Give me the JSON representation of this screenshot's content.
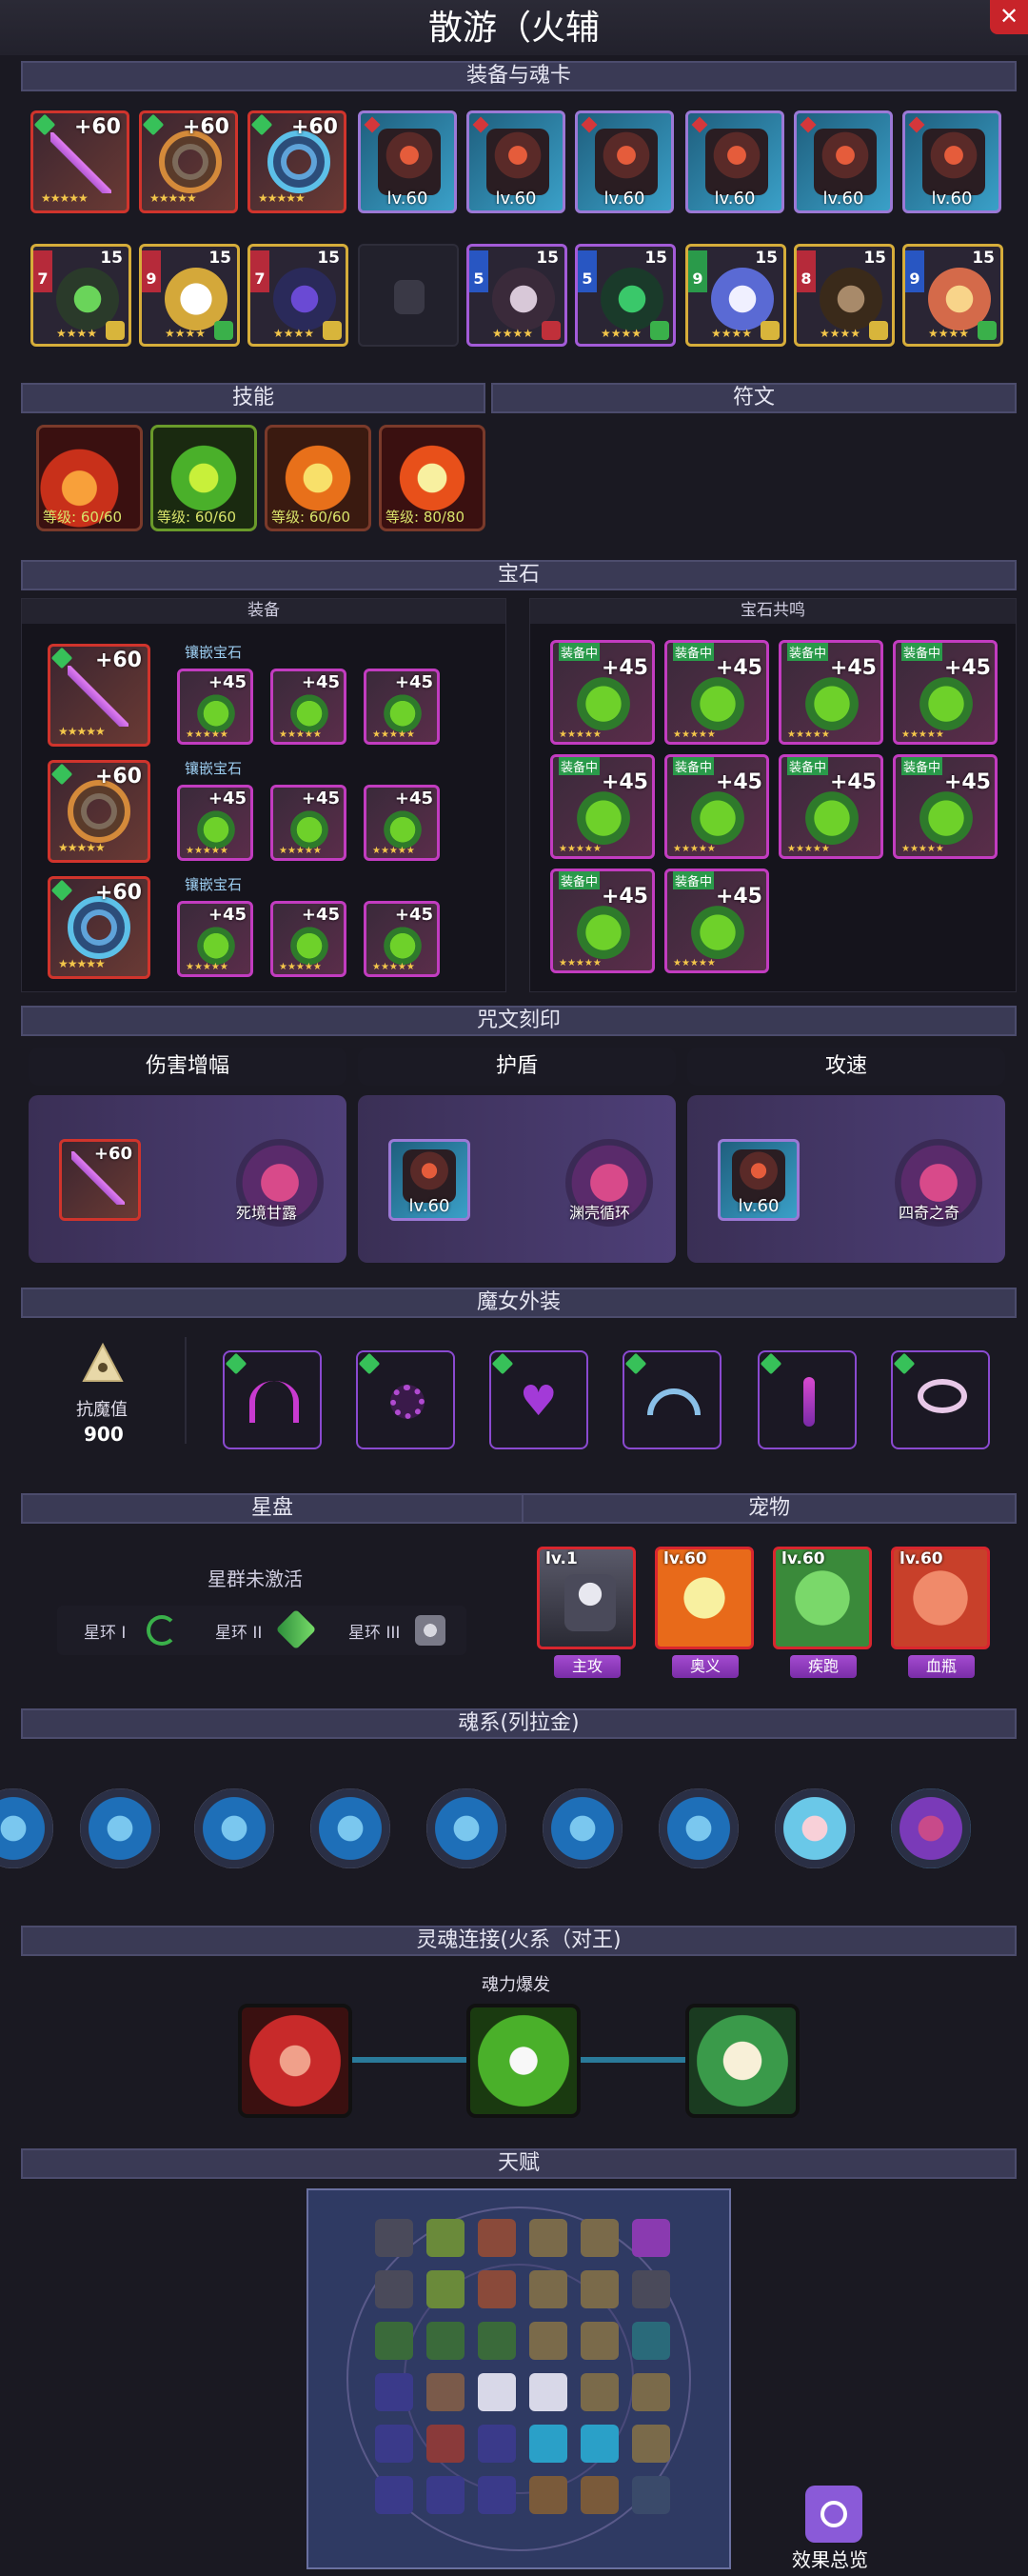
{
  "window": {
    "title": "散游（火辅"
  },
  "sections": {
    "equip_cards": "装备与魂卡",
    "skills": "技能",
    "runes": "符文",
    "gems": "宝石",
    "gems_equip": "装备",
    "gems_resonance": "宝石共鸣",
    "curse": "咒文刻印",
    "witch": "魔女外装",
    "star": "星盘",
    "pet": "宠物",
    "soul": "魂系(列拉金)",
    "soul_link": "灵魂连接(火系（对王)",
    "talent": "天赋"
  },
  "equipment": [
    {
      "plus": "+60"
    },
    {
      "plus": "+60"
    },
    {
      "plus": "+60"
    },
    {
      "lv": "lv.60"
    },
    {
      "lv": "lv.60"
    },
    {
      "lv": "lv.60"
    },
    {
      "lv": "lv.60"
    },
    {
      "lv": "lv.60"
    },
    {
      "lv": "lv.60"
    }
  ],
  "soul_cards": [
    {
      "side": "7",
      "num": "15"
    },
    {
      "side": "9",
      "num": "15"
    },
    {
      "side": "7",
      "num": "15"
    },
    {
      "empty": true
    },
    {
      "side": "5",
      "num": "15"
    },
    {
      "side": "5",
      "num": "15"
    },
    {
      "side": "9",
      "num": "15"
    },
    {
      "side": "8",
      "num": "15"
    },
    {
      "side": "9",
      "num": "15"
    }
  ],
  "skills": [
    {
      "level": "等级: 60/60"
    },
    {
      "level": "等级: 60/60"
    },
    {
      "level": "等级: 60/60"
    },
    {
      "level": "等级: 80/80"
    }
  ],
  "gems": {
    "inset_label": "镶嵌宝石",
    "equip_plus": "+60",
    "gem_plus": "+45",
    "equip_tag": "装备中"
  },
  "curse": {
    "columns": [
      {
        "head": "伤害增幅",
        "item": "+60",
        "name": "死境甘露"
      },
      {
        "head": "护盾",
        "item": "lv.60",
        "name": "渊壳循环"
      },
      {
        "head": "攻速",
        "item": "lv.60",
        "name": "四奇之奇"
      }
    ]
  },
  "witch": {
    "resist_label": "抗魔值",
    "resist_value": "900"
  },
  "star": {
    "status": "星群未激活",
    "rings": [
      "星环 I",
      "星环 II",
      "星环 III"
    ]
  },
  "pets": [
    {
      "lv": "lv.1",
      "role": "主攻"
    },
    {
      "lv": "lv.60",
      "role": "奥义"
    },
    {
      "lv": "lv.60",
      "role": "疾跑"
    },
    {
      "lv": "lv.60",
      "role": "血瓶"
    }
  ],
  "soul_link": {
    "burst": "魂力爆发"
  },
  "talent": {
    "overview": "效果总览"
  },
  "colors": {
    "bar": "#3a3a55",
    "accent": "#a44bd0",
    "close": "#c8242a"
  }
}
